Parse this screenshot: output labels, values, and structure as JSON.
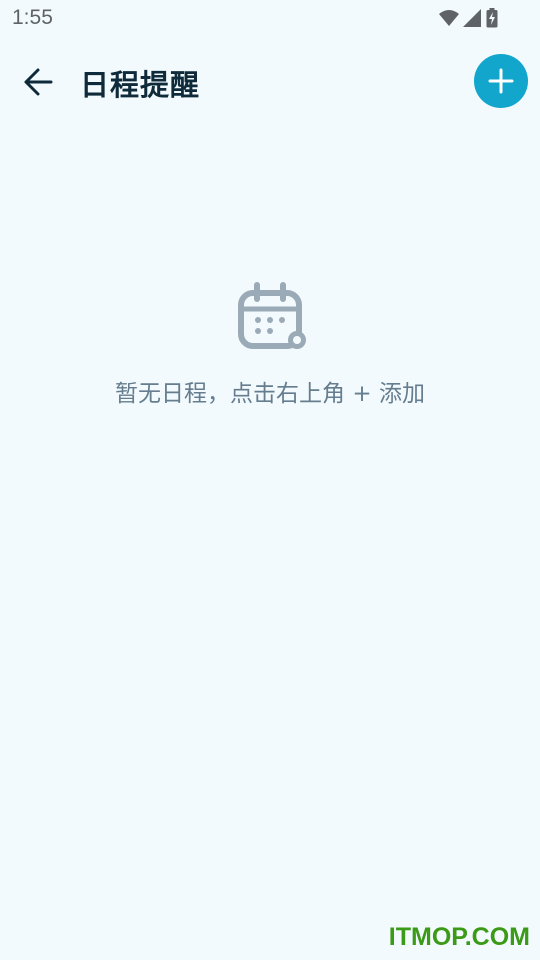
{
  "status_bar": {
    "time": "1:55",
    "icons": [
      "wifi-icon",
      "signal-icon",
      "battery-icon"
    ]
  },
  "app_bar": {
    "back_icon": "arrow-left-icon",
    "title": "日程提醒",
    "add_icon": "plus-icon"
  },
  "empty_state": {
    "icon": "calendar-icon",
    "message": "暂无日程，点击右上角 + 添加"
  },
  "watermark": "ITMOP.COM",
  "colors": {
    "background": "#f2fafd",
    "accent": "#12a6cd",
    "title": "#0f2a3a",
    "muted_text": "#657d8e",
    "icon_gray": "#9aaab6",
    "watermark": "#3b9a16"
  }
}
